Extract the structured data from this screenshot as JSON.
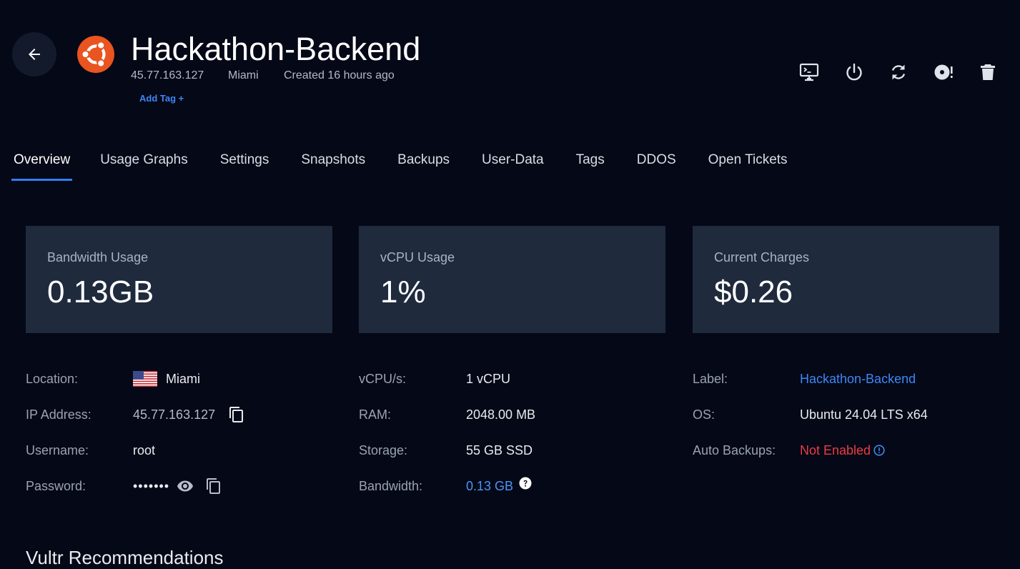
{
  "header": {
    "title": "Hackathon-Backend",
    "ip": "45.77.163.127",
    "location": "Miami",
    "created": "Created 16 hours ago",
    "add_tag": "Add Tag +"
  },
  "actions": [
    {
      "name": "console-icon"
    },
    {
      "name": "power-icon"
    },
    {
      "name": "restart-icon"
    },
    {
      "name": "reinstall-icon"
    },
    {
      "name": "trash-icon"
    }
  ],
  "tabs": [
    {
      "label": "Overview",
      "active": true
    },
    {
      "label": "Usage Graphs"
    },
    {
      "label": "Settings"
    },
    {
      "label": "Snapshots"
    },
    {
      "label": "Backups"
    },
    {
      "label": "User-Data"
    },
    {
      "label": "Tags"
    },
    {
      "label": "DDOS"
    },
    {
      "label": "Open Tickets"
    }
  ],
  "cards": [
    {
      "label": "Bandwidth Usage",
      "value": "0.13GB"
    },
    {
      "label": "vCPU Usage",
      "value": "1%"
    },
    {
      "label": "Current Charges",
      "value": "$0.26"
    }
  ],
  "details": {
    "col1": {
      "location_label": "Location:",
      "location_value": "Miami",
      "ip_label": "IP Address:",
      "ip_value": "45.77.163.127",
      "username_label": "Username:",
      "username_value": "root",
      "password_label": "Password:",
      "password_value": "•••••••"
    },
    "col2": {
      "vcpu_label": "vCPU/s:",
      "vcpu_value": "1 vCPU",
      "ram_label": "RAM:",
      "ram_value": "2048.00 MB",
      "storage_label": "Storage:",
      "storage_value": "55 GB SSD",
      "bandwidth_label": "Bandwidth:",
      "bandwidth_value": "0.13 GB"
    },
    "col3": {
      "label_label": "Label:",
      "label_value": "Hackathon-Backend",
      "os_label": "OS:",
      "os_value": "Ubuntu 24.04 LTS x64",
      "backups_label": "Auto Backups:",
      "backups_value": "Not Enabled"
    }
  },
  "section": {
    "heading": "Vultr Recommendations"
  },
  "colors": {
    "background": "#050816",
    "card": "#1f2a3d",
    "accent": "#2f7ff2",
    "link": "#3d87f5",
    "danger": "#ea3d45",
    "ubuntu": "#e95420"
  }
}
